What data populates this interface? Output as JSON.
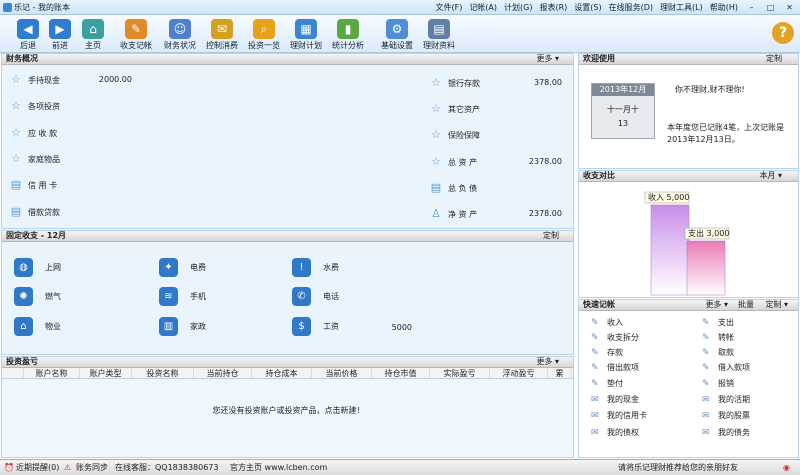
{
  "window": {
    "title": "乐记 - 我的账本",
    "controls": [
      "–",
      "□",
      "✕"
    ]
  },
  "menu": [
    "文件(F)",
    "记帐(A)",
    "计划(G)",
    "报表(R)",
    "设置(S)",
    "在线服务(D)",
    "理财工具(L)",
    "帮助(H)"
  ],
  "toolbar": [
    {
      "label": "后退",
      "icon": "back-arrow-icon",
      "color": "#2e7dd1"
    },
    {
      "label": "前进",
      "icon": "forward-arrow-icon",
      "color": "#2e7dd1"
    },
    {
      "label": "主页",
      "icon": "home-icon",
      "color": "#3aa0a0"
    },
    {
      "label": "收支记帐",
      "icon": "pencil-icon",
      "color": "#e08a2a"
    },
    {
      "label": "财务状况",
      "icon": "people-icon",
      "color": "#4f7fcf"
    },
    {
      "label": "控制消费",
      "icon": "envelope-icon",
      "color": "#d4a020"
    },
    {
      "label": "投资一览",
      "icon": "magnifier-icon",
      "color": "#e8a21a"
    },
    {
      "label": "理财计划",
      "icon": "calendar-icon",
      "color": "#3b86d0"
    },
    {
      "label": "统计分析",
      "icon": "bar-chart-icon",
      "color": "#5aa840"
    },
    {
      "label": "基础设置",
      "icon": "gear-icon",
      "color": "#4f8ed6"
    },
    {
      "label": "理财资料",
      "icon": "book-icon",
      "color": "#5f7fa8"
    }
  ],
  "finance": {
    "title": "财务概况",
    "more": "更多",
    "left": [
      {
        "label": "手持现金",
        "value": "2000.00"
      },
      {
        "label": "各项投资",
        "value": ""
      },
      {
        "label": "应 收 款",
        "value": ""
      },
      {
        "label": "家庭物品",
        "value": ""
      },
      {
        "label": "信 用 卡",
        "value": ""
      },
      {
        "label": "借款贷款",
        "value": ""
      }
    ],
    "right": [
      {
        "label": "银行存款",
        "value": "378.00"
      },
      {
        "label": "其它资产",
        "value": ""
      },
      {
        "label": "保险保障",
        "value": ""
      },
      {
        "label": "总 资 产",
        "value": "2378.00"
      },
      {
        "label": "总 负 债",
        "value": ""
      },
      {
        "label": "净 资 产",
        "value": "2378.00"
      }
    ]
  },
  "fixed": {
    "title": "固定收支 - 12月",
    "custom": "定制",
    "items": [
      {
        "label": "上网",
        "value": "",
        "icon": "globe-icon"
      },
      {
        "label": "电费",
        "value": "",
        "icon": "lightbulb-icon"
      },
      {
        "label": "水费",
        "value": "",
        "icon": "exclamation-icon"
      },
      {
        "label": "燃气",
        "value": "",
        "icon": "flame-icon"
      },
      {
        "label": "手机",
        "value": "",
        "icon": "signal-icon"
      },
      {
        "label": "电话",
        "value": "",
        "icon": "phone-icon"
      },
      {
        "label": "物业",
        "value": "",
        "icon": "house-icon"
      },
      {
        "label": "家政",
        "value": "",
        "icon": "trash-icon"
      },
      {
        "label": "工资",
        "value": "5000",
        "icon": "dollar-icon"
      }
    ]
  },
  "invest": {
    "title": "投资盈亏",
    "more": "更多",
    "columns": [
      "账户名称",
      "账户类型",
      "投资名称",
      "当前持仓",
      "持仓成本",
      "当前价格",
      "持仓市值",
      "实际盈亏",
      "浮动盈亏",
      "累"
    ],
    "empty": "您还没有投资账户或投资产品，点击新建！"
  },
  "welcome": {
    "title": "欢迎使用",
    "custom": "定制",
    "calendar_month": "2013年12月",
    "calendar_label": "十一月十",
    "calendar_day": "13",
    "slogan": "你不理财,财不理你!",
    "message": "本年度您已记账4笔，上次记账是2013年12月13日。"
  },
  "compare": {
    "title": "收支对比",
    "period": "本月",
    "income_label": "收入",
    "expense_label": "支出",
    "income_value_text": "5,000",
    "expense_value_text": "3,000"
  },
  "chart_data": {
    "type": "bar",
    "categories": [
      "收入",
      "支出"
    ],
    "values": [
      5000,
      3000
    ],
    "colors": [
      "#c98ee8",
      "#ea7bb6"
    ]
  },
  "quick": {
    "title": "快速记帐",
    "more": "更多",
    "batch": "批量",
    "custom": "定制",
    "items": [
      {
        "label": "收入"
      },
      {
        "label": "支出"
      },
      {
        "label": "收支拆分"
      },
      {
        "label": "转帐"
      },
      {
        "label": "存款"
      },
      {
        "label": "取款"
      },
      {
        "label": "借出款项"
      },
      {
        "label": "借入款项"
      },
      {
        "label": "垫付"
      },
      {
        "label": "报销"
      },
      {
        "label": "我的现金"
      },
      {
        "label": "我的活期"
      },
      {
        "label": "我的信用卡"
      },
      {
        "label": "我的股票"
      },
      {
        "label": "我的债权"
      },
      {
        "label": "我的债务"
      }
    ]
  },
  "status": {
    "reminder": "近期提醒(0)",
    "sync": "账务同步",
    "service": "在线客服：QQ1838380673",
    "site": "官方主页 www.lcben.com",
    "recommend": "请将乐记理财推荐给您的亲朋好友"
  }
}
